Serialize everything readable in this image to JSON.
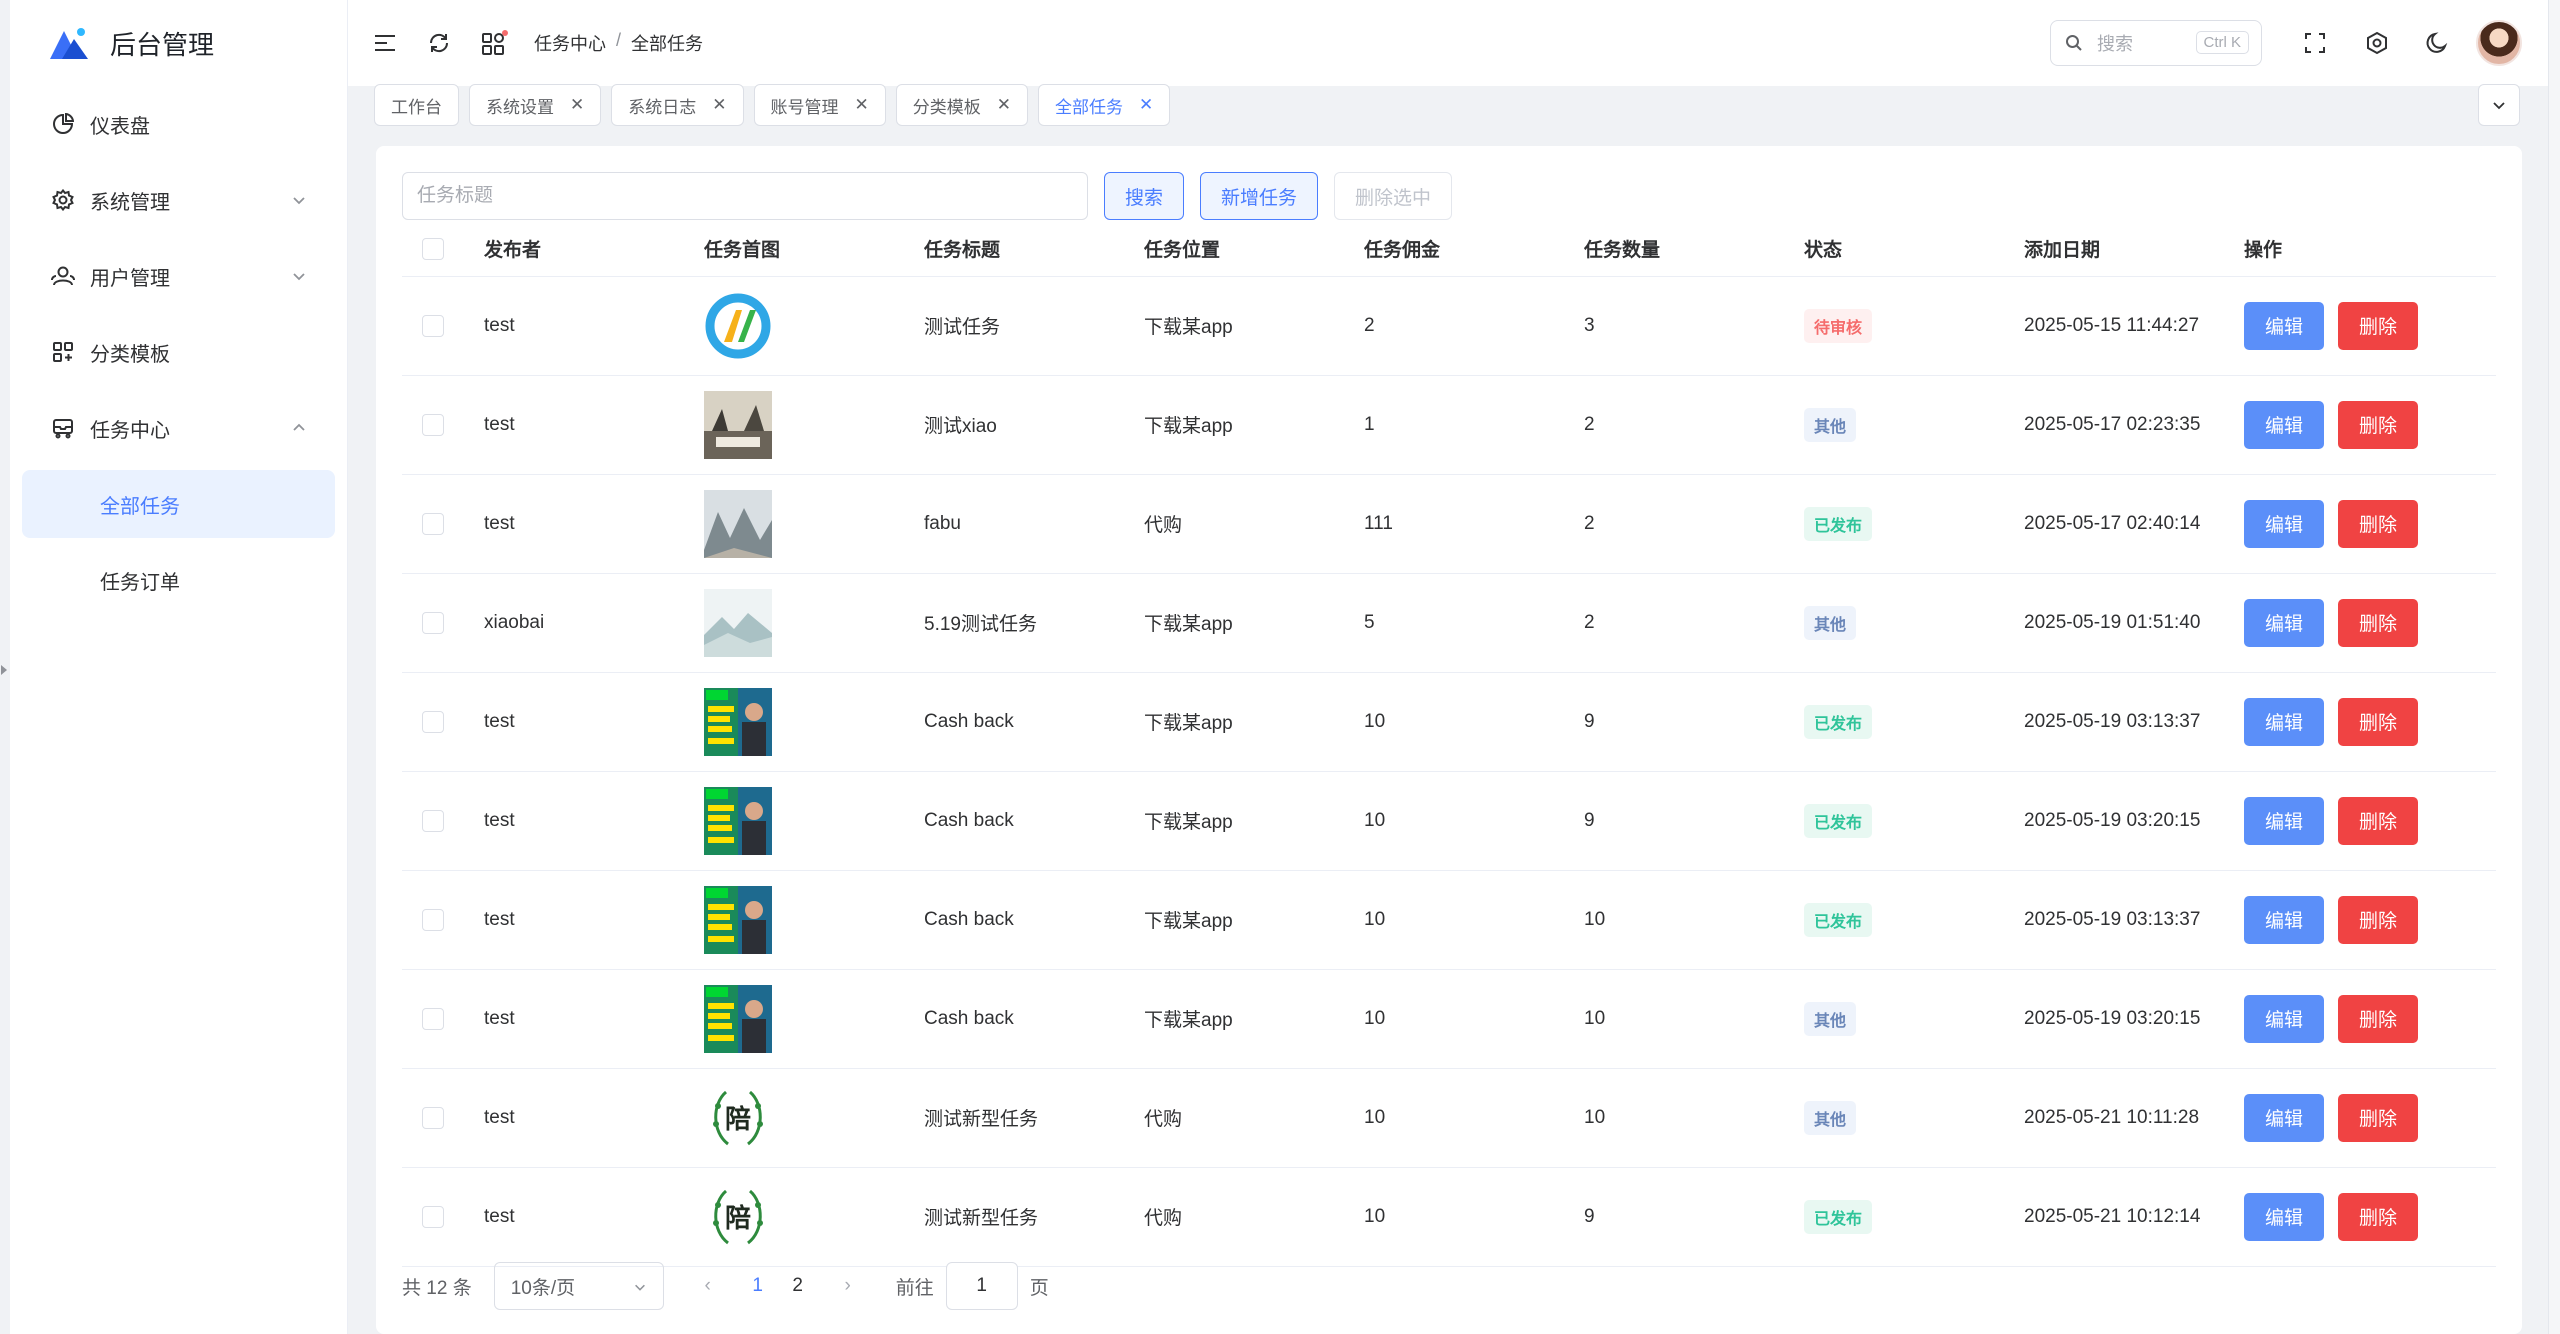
{
  "app": {
    "title": "后台管理"
  },
  "sidebar": {
    "items": [
      {
        "label": "仪表盘",
        "icon": "pie-chart-icon"
      },
      {
        "label": "系统管理",
        "icon": "gear-icon",
        "expandable": true
      },
      {
        "label": "用户管理",
        "icon": "users-icon",
        "expandable": true
      },
      {
        "label": "分类模板",
        "icon": "grid-icon"
      },
      {
        "label": "任务中心",
        "icon": "tray-icon",
        "expandable": true,
        "expanded": true
      }
    ],
    "subitems": [
      {
        "label": "全部任务",
        "active": true
      },
      {
        "label": "任务订单",
        "active": false
      }
    ]
  },
  "header": {
    "breadcrumb": [
      "任务中心",
      "全部任务"
    ],
    "breadcrumb_sep": "/",
    "search_placeholder": "搜索",
    "search_shortcut": "Ctrl K"
  },
  "tags": [
    {
      "label": "工作台",
      "closable": false
    },
    {
      "label": "系统设置",
      "closable": true
    },
    {
      "label": "系统日志",
      "closable": true
    },
    {
      "label": "账号管理",
      "closable": true
    },
    {
      "label": "分类模板",
      "closable": true
    },
    {
      "label": "全部任务",
      "closable": true,
      "active": true
    }
  ],
  "toolbar": {
    "search_placeholder": "任务标题",
    "search_button": "搜索",
    "add_button": "新增任务",
    "delete_selected_button": "删除选中"
  },
  "table": {
    "columns": [
      "发布者",
      "任务首图",
      "任务标题",
      "任务位置",
      "任务佣金",
      "任务数量",
      "状态",
      "添加日期",
      "操作"
    ],
    "edit_label": "编辑",
    "delete_label": "删除",
    "rows": [
      {
        "publisher": "test",
        "image": "app-logo-thumb",
        "title": "测试任务",
        "location": "下载某app",
        "commission": "2",
        "quantity": "3",
        "status": "待审核",
        "status_type": "pending",
        "date": "2025-05-15 11:44:27"
      },
      {
        "publisher": "test",
        "image": "painting-thumb",
        "title": "测试xiao",
        "location": "下载某app",
        "commission": "1",
        "quantity": "2",
        "status": "其他",
        "status_type": "other",
        "date": "2025-05-17 02:23:35"
      },
      {
        "publisher": "test",
        "image": "landscape-thumb",
        "title": "fabu",
        "location": "代购",
        "commission": "111",
        "quantity": "2",
        "status": "已发布",
        "status_type": "published",
        "date": "2025-05-17 02:40:14"
      },
      {
        "publisher": "xiaobai",
        "image": "mountain-thumb",
        "title": "5.19测试任务",
        "location": "下载某app",
        "commission": "5",
        "quantity": "2",
        "status": "其他",
        "status_type": "other",
        "date": "2025-05-19 01:51:40"
      },
      {
        "publisher": "test",
        "image": "cashapp-thumb",
        "title": "Cash back",
        "location": "下载某app",
        "commission": "10",
        "quantity": "9",
        "status": "已发布",
        "status_type": "published",
        "date": "2025-05-19 03:13:37"
      },
      {
        "publisher": "test",
        "image": "cashapp-thumb",
        "title": "Cash back",
        "location": "下载某app",
        "commission": "10",
        "quantity": "9",
        "status": "已发布",
        "status_type": "published",
        "date": "2025-05-19 03:20:15"
      },
      {
        "publisher": "test",
        "image": "cashapp-thumb",
        "title": "Cash back",
        "location": "下载某app",
        "commission": "10",
        "quantity": "10",
        "status": "已发布",
        "status_type": "published",
        "date": "2025-05-19 03:13:37"
      },
      {
        "publisher": "test",
        "image": "cashapp-thumb",
        "title": "Cash back",
        "location": "下载某app",
        "commission": "10",
        "quantity": "10",
        "status": "其他",
        "status_type": "other",
        "date": "2025-05-19 03:20:15"
      },
      {
        "publisher": "test",
        "image": "pei-logo-thumb",
        "title": "测试新型任务",
        "location": "代购",
        "commission": "10",
        "quantity": "10",
        "status": "其他",
        "status_type": "other",
        "date": "2025-05-21 10:11:28"
      },
      {
        "publisher": "test",
        "image": "pei-logo-thumb",
        "title": "测试新型任务",
        "location": "代购",
        "commission": "10",
        "quantity": "9",
        "status": "已发布",
        "status_type": "published",
        "date": "2025-05-21 10:12:14"
      }
    ]
  },
  "pagination": {
    "total_label": "共 12 条",
    "page_size": "10条/页",
    "pages": [
      "1",
      "2"
    ],
    "current_page": "1",
    "goto_prefix": "前往",
    "goto_value": "1",
    "goto_suffix": "页"
  },
  "colors": {
    "primary": "#4a7dff",
    "edit": "#5b8ff9",
    "delete": "#f04343",
    "pending": "#f56c6c",
    "published": "#2fc49a",
    "other": "#6a86b8"
  }
}
